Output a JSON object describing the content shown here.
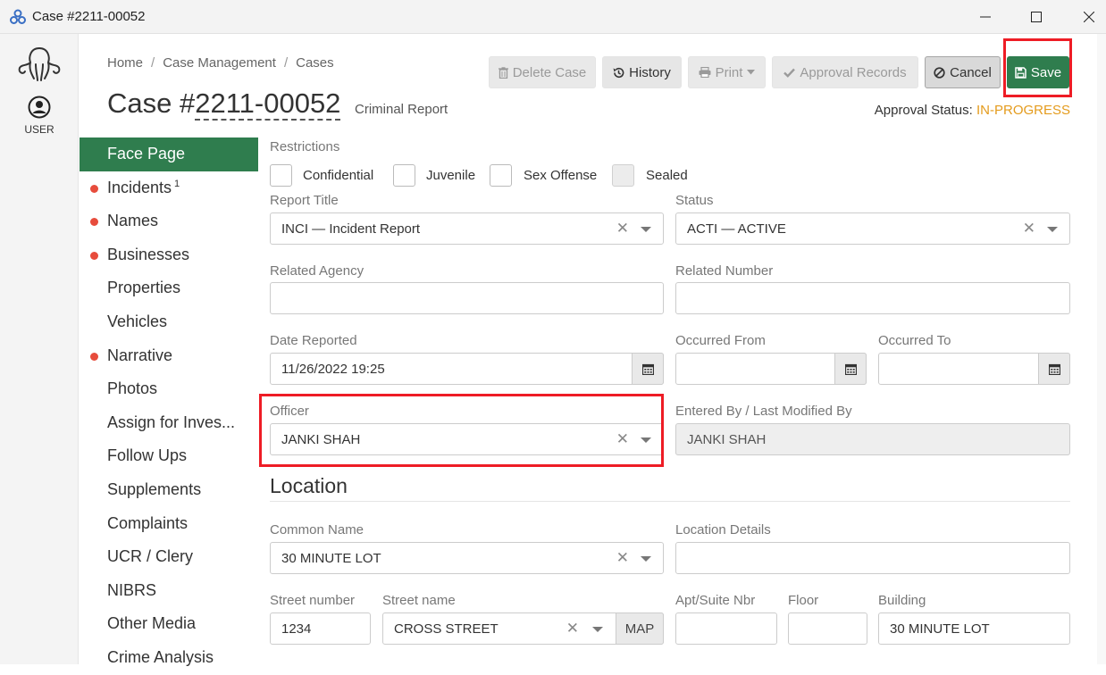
{
  "window": {
    "title": "Case #2211-00052"
  },
  "rail": {
    "user_label": "USER"
  },
  "breadcrumb": [
    "Home",
    "Case Management",
    "Cases"
  ],
  "header": {
    "title_prefix": "Case #",
    "case_number": "2211-00052",
    "subtitle": "Criminal Report"
  },
  "toolbar": {
    "delete": "Delete Case",
    "history": "History",
    "print": "Print",
    "approval_records": "Approval Records",
    "cancel": "Cancel",
    "save": "Save"
  },
  "approval": {
    "label": "Approval Status:",
    "value": "IN-PROGRESS"
  },
  "nav": [
    {
      "label": "Face Page",
      "active": true,
      "dot": false
    },
    {
      "label": "Incidents",
      "dot": true,
      "badge": "1"
    },
    {
      "label": "Names",
      "dot": true
    },
    {
      "label": "Businesses",
      "dot": true
    },
    {
      "label": "Properties",
      "dot": false
    },
    {
      "label": "Vehicles",
      "dot": false
    },
    {
      "label": "Narrative",
      "dot": true
    },
    {
      "label": "Photos",
      "dot": false
    },
    {
      "label": "Assign for Inves...",
      "dot": false
    },
    {
      "label": "Follow Ups",
      "dot": false
    },
    {
      "label": "Supplements",
      "dot": false
    },
    {
      "label": "Complaints",
      "dot": false
    },
    {
      "label": "UCR / Clery",
      "dot": false
    },
    {
      "label": "NIBRS",
      "dot": false
    },
    {
      "label": "Other Media",
      "dot": false
    },
    {
      "label": "Crime Analysis",
      "dot": false
    }
  ],
  "form": {
    "restrictions_label": "Restrictions",
    "restrictions": [
      "Confidential",
      "Juvenile",
      "Sex Offense",
      "Sealed"
    ],
    "report_title": {
      "label": "Report Title",
      "value": "INCI — Incident Report"
    },
    "status": {
      "label": "Status",
      "value": "ACTI — ACTIVE"
    },
    "related_agency": {
      "label": "Related Agency",
      "value": ""
    },
    "related_number": {
      "label": "Related Number",
      "value": ""
    },
    "date_reported": {
      "label": "Date Reported",
      "value": "11/26/2022 19:25"
    },
    "occurred_from": {
      "label": "Occurred From",
      "value": ""
    },
    "occurred_to": {
      "label": "Occurred To",
      "value": ""
    },
    "officer": {
      "label": "Officer",
      "value": "JANKI SHAH"
    },
    "entered_by": {
      "label": "Entered By / Last Modified By",
      "value": "JANKI SHAH"
    },
    "location_title": "Location",
    "common_name": {
      "label": "Common Name",
      "value": "30 MINUTE LOT"
    },
    "location_details": {
      "label": "Location Details",
      "value": ""
    },
    "street_number": {
      "label": "Street number",
      "value": "1234"
    },
    "street_name": {
      "label": "Street name",
      "value": "CROSS STREET"
    },
    "map_label": "MAP",
    "apt_suite": {
      "label": "Apt/Suite Nbr",
      "value": ""
    },
    "floor": {
      "label": "Floor",
      "value": ""
    },
    "building": {
      "label": "Building",
      "value": "30 MINUTE LOT"
    }
  },
  "colors": {
    "accent": "#2f7d4e",
    "status_in_progress": "#e49b1c",
    "highlight": "#ee1c25",
    "nav_dot": "#e74c3c"
  }
}
